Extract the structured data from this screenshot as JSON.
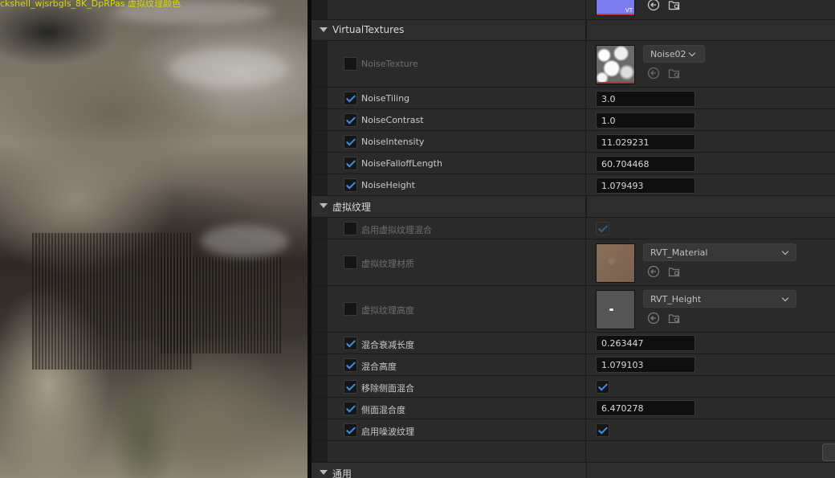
{
  "viewport": {
    "overlay_text": "ckshell_wjsrbgls_8K_DpRPas 虚拟纹理颜色",
    "overlay_color": "#d8d800"
  },
  "panel": {
    "top_row": {
      "thumbnail_badge": "VT"
    },
    "categories": {
      "virtual_textures": "VirtualTextures",
      "virtual_texture_cn": "虚拟纹理",
      "general": "通用"
    },
    "properties": {
      "noise_texture": {
        "label": "NoiseTexture",
        "checked": false,
        "asset": "Noise02"
      },
      "noise_tiling": {
        "label": "NoiseTiling",
        "checked": true,
        "value": "3.0"
      },
      "noise_contrast": {
        "label": "NoiseContrast",
        "checked": true,
        "value": "1.0"
      },
      "noise_intensity": {
        "label": "NoiseIntensity",
        "checked": true,
        "value": "11.029231"
      },
      "noise_falloff_length": {
        "label": "NoiseFalloffLength",
        "checked": true,
        "value": "60.704468"
      },
      "noise_height": {
        "label": "NoiseHeight",
        "checked": true,
        "value": "1.079493"
      },
      "enable_vt_blend": {
        "label": "启用虚拟纹理混合",
        "checked": false,
        "value_checked": true
      },
      "vt_material": {
        "label": "虚拟纹理材质",
        "checked": false,
        "asset": "RVT_Material"
      },
      "vt_height": {
        "label": "虚拟纹理高度",
        "checked": false,
        "asset": "RVT_Height"
      },
      "blend_falloff_length": {
        "label": "混合衰减长度",
        "checked": true,
        "value": "0.263447"
      },
      "blend_height": {
        "label": "混合高度",
        "checked": true,
        "value": "1.079103"
      },
      "remove_side_blend": {
        "label": "移除侧面混合",
        "checked": true,
        "value_checked": true
      },
      "side_blend_amount": {
        "label": "侧面混合度",
        "checked": true,
        "value": "6.470278"
      },
      "enable_noise_texture": {
        "label": "启用噪波纹理",
        "checked": true,
        "value_checked": true
      }
    }
  },
  "colors": {
    "accent_check": "#3b8fe8",
    "panel_bg": "#242424",
    "field_bg": "#0f0f0f"
  }
}
